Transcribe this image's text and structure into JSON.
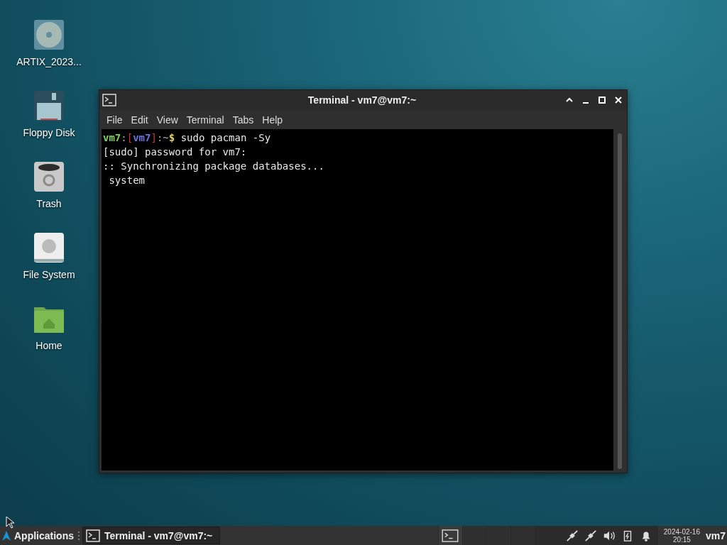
{
  "desktop_icons": [
    {
      "kind": "disc",
      "label": "ARTIX_2023..."
    },
    {
      "kind": "floppy",
      "label": "Floppy Disk"
    },
    {
      "kind": "trash",
      "label": "Trash"
    },
    {
      "kind": "drive",
      "label": "File System"
    },
    {
      "kind": "folder",
      "label": "Home"
    }
  ],
  "window": {
    "title": "Terminal - vm7@vm7:~",
    "menu": [
      "File",
      "Edit",
      "View",
      "Terminal",
      "Tabs",
      "Help"
    ],
    "lines": [
      [
        {
          "kind": "user",
          "text": "vm7"
        },
        {
          "kind": "punct",
          "text": ":"
        },
        {
          "kind": "bracket",
          "text": "["
        },
        {
          "kind": "host",
          "text": "vm7"
        },
        {
          "kind": "bracket",
          "text": "]"
        },
        {
          "kind": "punct",
          "text": ":~"
        },
        {
          "kind": "dollar",
          "text": "$"
        },
        {
          "kind": "plain",
          "text": " sudo pacman -Sy"
        }
      ],
      [
        {
          "kind": "plain",
          "text": "[sudo] password for vm7:"
        }
      ],
      [
        {
          "kind": "plain",
          "text": ":: Synchronizing package databases..."
        }
      ],
      [
        {
          "kind": "plain",
          "text": " system"
        }
      ]
    ]
  },
  "taskbar": {
    "apps_label": "Applications",
    "tasks": [
      {
        "label": "Terminal - vm7@vm7:~",
        "selected": true
      }
    ],
    "workspaces": [
      {
        "selected": true
      },
      {
        "selected": false
      },
      {
        "selected": false
      },
      {
        "selected": false
      }
    ],
    "date": "2024-02-16",
    "time": "20:15",
    "user": "vm7"
  }
}
